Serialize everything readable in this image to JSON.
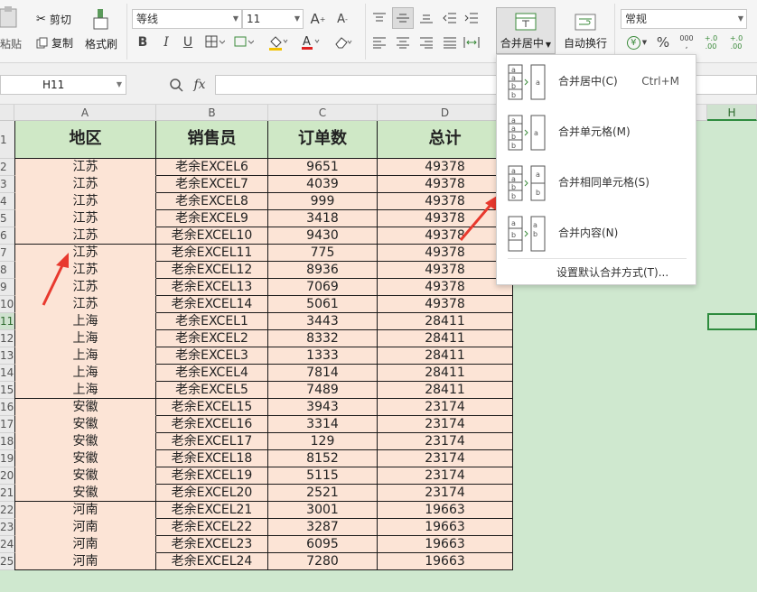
{
  "ribbon": {
    "paste_label": "粘贴",
    "cut_label": "剪切",
    "copy_label": "复制",
    "format_painter_label": "格式刷",
    "font_name": "等线",
    "font_size": "11",
    "bold": "B",
    "italic": "I",
    "underline": "U",
    "merge_center_label": "合并居中",
    "wrap_text_label": "自动换行",
    "number_format": "常规",
    "currency_symbol": "¥",
    "percent_symbol": "%",
    "thousands_label": "000",
    "increase_decimal_label": "+.0 .00",
    "decrease_decimal_label": "+.0 .00"
  },
  "formula_bar": {
    "name_box": "H11",
    "fx_label": "fx",
    "formula": ""
  },
  "columns": [
    "A",
    "B",
    "C",
    "D",
    "H"
  ],
  "row_numbers": [
    "1",
    "2",
    "3",
    "4",
    "5",
    "6",
    "7",
    "8",
    "9",
    "10",
    "11",
    "12",
    "13",
    "14",
    "15",
    "16",
    "17",
    "18",
    "19",
    "20",
    "21",
    "22",
    "23",
    "24",
    "25"
  ],
  "table": {
    "headers": [
      "地区",
      "销售员",
      "订单数",
      "总计"
    ],
    "rows": [
      [
        "江苏",
        "老余EXCEL6",
        "9651",
        "49378"
      ],
      [
        "江苏",
        "老余EXCEL7",
        "4039",
        "49378"
      ],
      [
        "江苏",
        "老余EXCEL8",
        "999",
        "49378"
      ],
      [
        "江苏",
        "老余EXCEL9",
        "3418",
        "49378"
      ],
      [
        "江苏",
        "老余EXCEL10",
        "9430",
        "49378"
      ],
      [
        "江苏",
        "老余EXCEL11",
        "775",
        "49378"
      ],
      [
        "江苏",
        "老余EXCEL12",
        "8936",
        "49378"
      ],
      [
        "江苏",
        "老余EXCEL13",
        "7069",
        "49378"
      ],
      [
        "江苏",
        "老余EXCEL14",
        "5061",
        "49378"
      ],
      [
        "上海",
        "老余EXCEL1",
        "3443",
        "28411"
      ],
      [
        "上海",
        "老余EXCEL2",
        "8332",
        "28411"
      ],
      [
        "上海",
        "老余EXCEL3",
        "1333",
        "28411"
      ],
      [
        "上海",
        "老余EXCEL4",
        "7814",
        "28411"
      ],
      [
        "上海",
        "老余EXCEL5",
        "7489",
        "28411"
      ],
      [
        "安徽",
        "老余EXCEL15",
        "3943",
        "23174"
      ],
      [
        "安徽",
        "老余EXCEL16",
        "3314",
        "23174"
      ],
      [
        "安徽",
        "老余EXCEL17",
        "129",
        "23174"
      ],
      [
        "安徽",
        "老余EXCEL18",
        "8152",
        "23174"
      ],
      [
        "安徽",
        "老余EXCEL19",
        "5115",
        "23174"
      ],
      [
        "安徽",
        "老余EXCEL20",
        "2521",
        "23174"
      ],
      [
        "河南",
        "老余EXCEL21",
        "3001",
        "19663"
      ],
      [
        "河南",
        "老余EXCEL22",
        "3287",
        "19663"
      ],
      [
        "河南",
        "老余EXCEL23",
        "6095",
        "19663"
      ],
      [
        "河南",
        "老余EXCEL24",
        "7280",
        "19663"
      ]
    ]
  },
  "merge_menu": {
    "items": [
      {
        "label": "合并居中(C)",
        "shortcut": "Ctrl+M"
      },
      {
        "label": "合并单元格(M)",
        "shortcut": ""
      },
      {
        "label": "合并相同单元格(S)",
        "shortcut": ""
      },
      {
        "label": "合并内容(N)",
        "shortcut": ""
      }
    ],
    "footer": "设置默认合并方式(T)...",
    "icon_letters": {
      "a": "a",
      "b": "b"
    }
  },
  "colors": {
    "header_fill": "#cfe8c6",
    "body_fill": "#fce4d6",
    "sheet_bg": "#cfe8cf",
    "arrow": "#e8392e",
    "selection": "#2e8b3e"
  }
}
